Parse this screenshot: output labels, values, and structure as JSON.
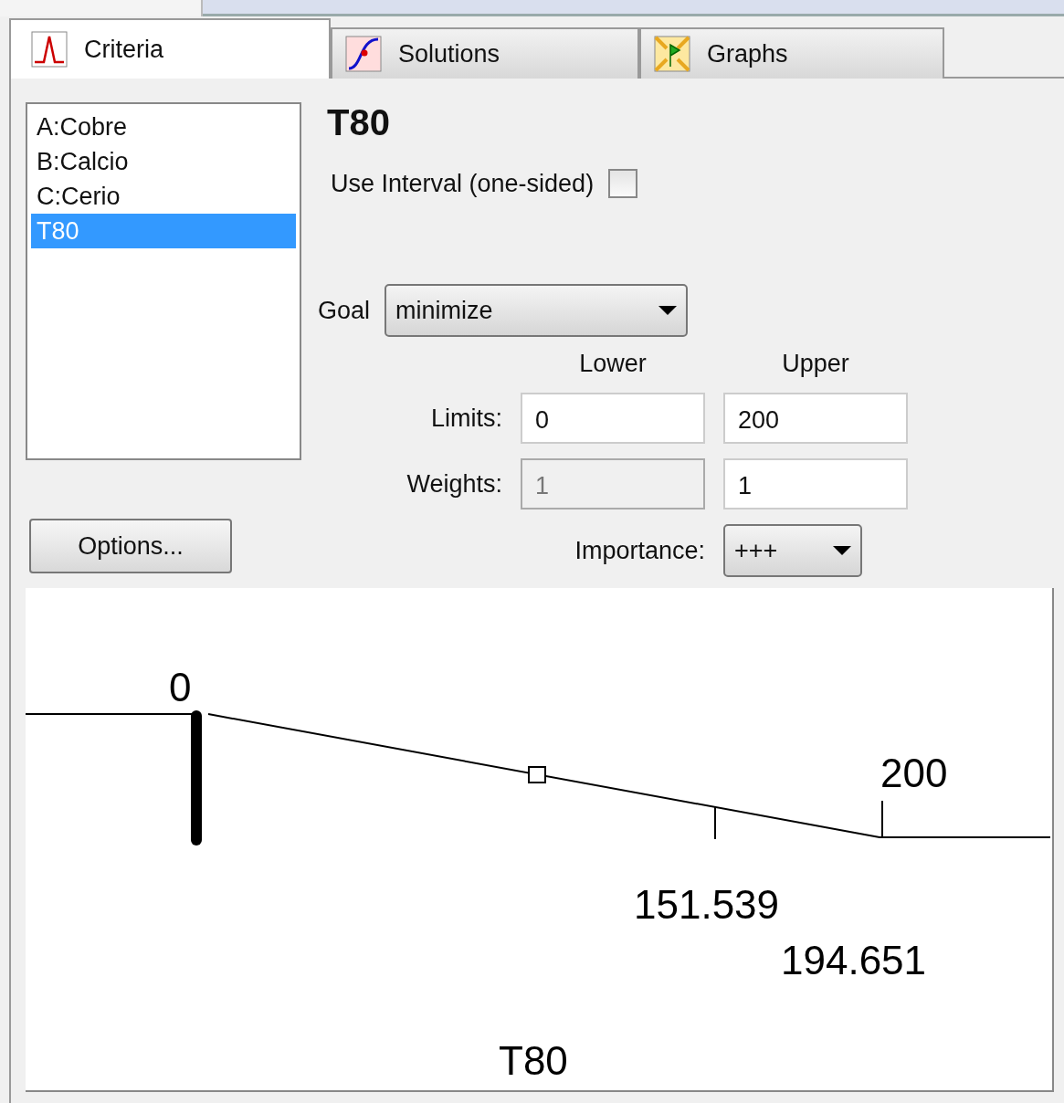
{
  "tabs": [
    {
      "label": "Criteria",
      "kind": "peak",
      "selected": true
    },
    {
      "label": "Solutions",
      "kind": "curve",
      "selected": false
    },
    {
      "label": "Graphs",
      "kind": "map",
      "selected": false
    }
  ],
  "criteria_list": [
    {
      "label": "A:Cobre",
      "selected": false
    },
    {
      "label": "B:Calcio",
      "selected": false
    },
    {
      "label": "C:Cerio",
      "selected": false
    },
    {
      "label": "T80",
      "selected": true
    }
  ],
  "title": "T80",
  "use_interval": {
    "label": "Use Interval (one-sided)",
    "checked": false
  },
  "goal": {
    "label": "Goal",
    "value": "minimize"
  },
  "headers": {
    "lower": "Lower",
    "upper": "Upper"
  },
  "limits": {
    "label": "Limits:",
    "lower": {
      "value": "0",
      "disabled": false
    },
    "upper": {
      "value": "200",
      "disabled": false
    }
  },
  "weights": {
    "label": "Weights:",
    "lower": {
      "value": "1",
      "disabled": true
    },
    "upper": {
      "value": "1",
      "disabled": false
    }
  },
  "importance": {
    "label": "Importance:",
    "value": "+++"
  },
  "options_button": "Options...",
  "plot": {
    "lower_label": "0",
    "upper_label": "200",
    "marker_label": "151.539",
    "value_label": "194.651",
    "axis_title": "T80"
  }
}
